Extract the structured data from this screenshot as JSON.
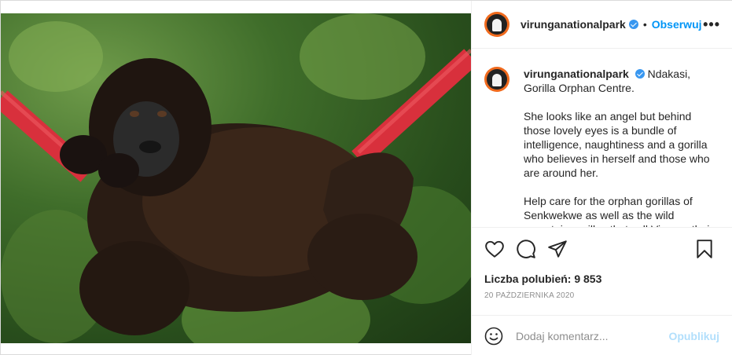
{
  "post": {
    "username": "virunganationalpark",
    "follow_label": "Obserwuj",
    "dot": "•",
    "more_label": "•••",
    "caption": {
      "first": "Ndakasi, Gorilla Orphan Centre.",
      "paragraphs": [
        "She looks like an angel but behind those lovely eyes is a bundle of intelligence, naughtiness and a gorilla who believes in herself and those who are around her.",
        "Help care for the orphan gorillas of Senkwekwe as well as the wild mountain gorillas that call Virunga their home via"
      ]
    },
    "likes": "Liczba polubień: 9 853",
    "date": "20 PAŹDZIERNIKA 2020",
    "comment": {
      "placeholder": "Dodaj komentarz...",
      "publish_label": "Opublikuj"
    }
  },
  "colors": {
    "accent": "#0095f6",
    "verified": "#3897f0",
    "publish_disabled": "#b2dffc"
  },
  "icons": [
    "heart-icon",
    "comment-icon",
    "share-icon",
    "bookmark-icon",
    "emoji-icon",
    "verified-icon",
    "more-icon"
  ]
}
